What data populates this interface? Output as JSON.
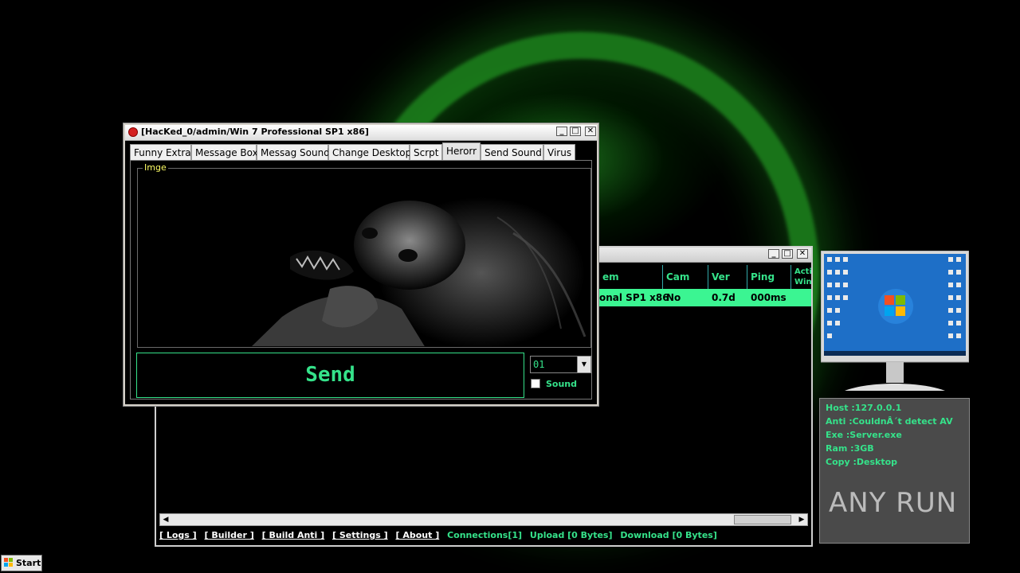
{
  "dialog": {
    "title": "[HacKed_0/admin/Win 7 Professional SP1 x86]",
    "tabs": [
      {
        "label": "Funny Extra"
      },
      {
        "label": "Message Box"
      },
      {
        "label": "Messag Sound"
      },
      {
        "label": "Change Desktop"
      },
      {
        "label": "Scrpt"
      },
      {
        "label": "Herorr",
        "active": true
      },
      {
        "label": "Send Sound"
      },
      {
        "label": "Virus"
      }
    ],
    "group_label": "Imge",
    "send_label": "Send",
    "combo_value": "01",
    "sound_label": "Sound",
    "sound_checked": false
  },
  "main_window": {
    "columns": [
      "em",
      "Cam",
      "Ver",
      "Ping",
      "Acti Win"
    ],
    "rows": [
      {
        "system": "onal SP1 x86",
        "cam": "No",
        "ver": "0.7d",
        "ping": "000ms"
      }
    ],
    "status_links": [
      "[ Logs ]",
      "[ Builder ]",
      "[ Build Anti ]",
      "[ Settings ]",
      "[ About ]"
    ],
    "connections": "Connections[1]",
    "upload": "Upload [0 Bytes]",
    "download": "Download [0 Bytes]"
  },
  "info_panel": {
    "host": "Host :127.0.0.1",
    "anti": "Anti :CouldnÂ´t detect AV",
    "exe": "Exe  :Server.exe",
    "ram": "Ram  :3GB",
    "copy": "Copy :Desktop"
  },
  "watermark": "ANY RUN",
  "taskbar": {
    "start_label": "Start"
  },
  "colors": {
    "accent_green": "#35e28a",
    "row_highlight": "#3bf592",
    "label_yellow": "#ffff66"
  }
}
